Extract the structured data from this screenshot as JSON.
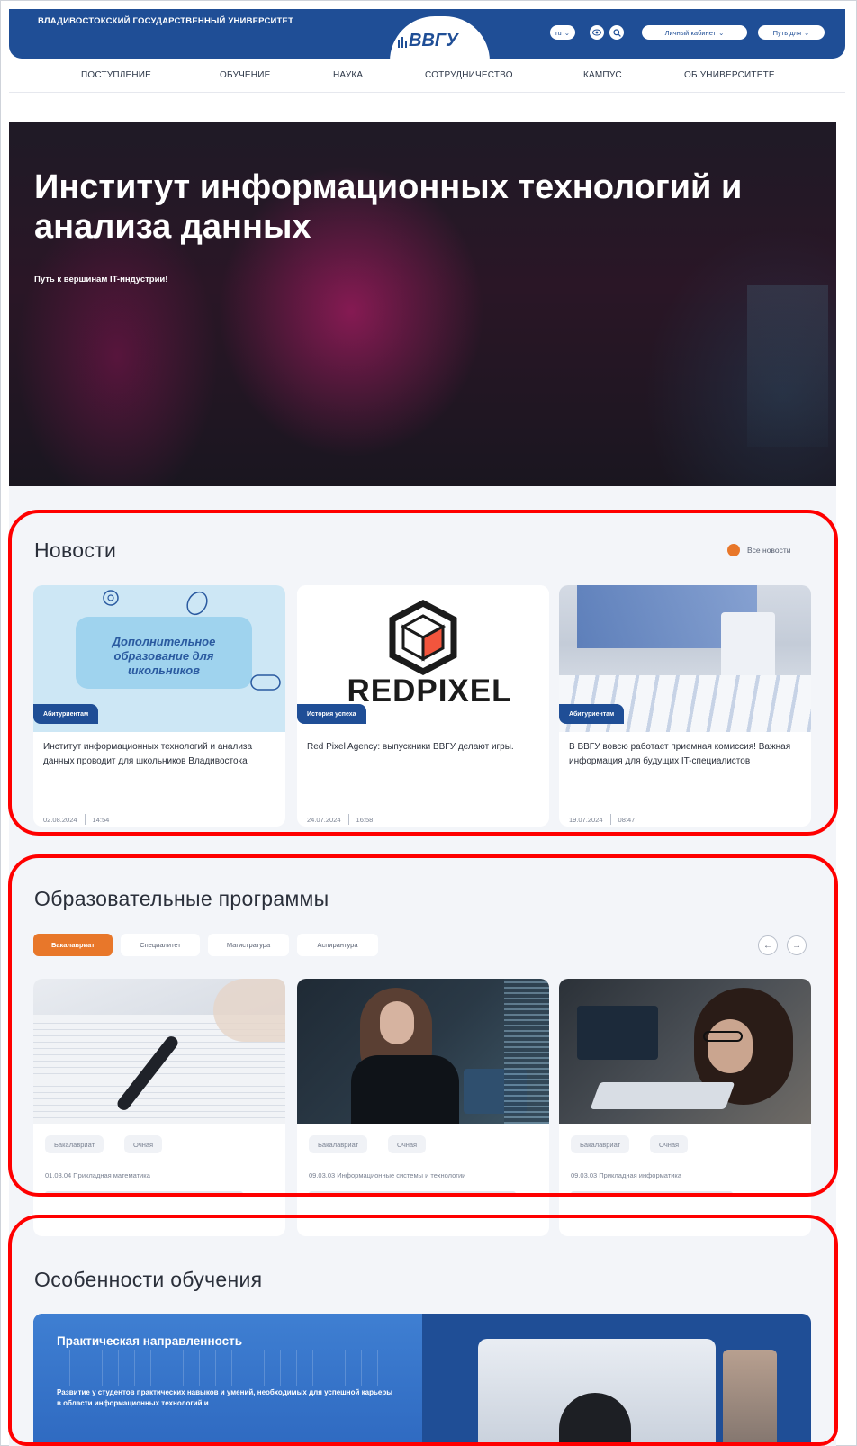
{
  "header": {
    "university": "ВЛАДИВОСТОКСКИЙ ГОСУДАРСТВЕННЫЙ УНИВЕРСИТЕТ",
    "logo": "ВВГУ",
    "lang": "ru",
    "cabinet_label": "Личный кабинет",
    "path_label": "Путь для",
    "brand_color": "#1f4e96"
  },
  "nav": {
    "items": [
      "ПОСТУПЛЕНИЕ",
      "ОБУЧЕНИЕ",
      "НАУКА",
      "СОТРУДНИЧЕСТВО",
      "КАМПУС",
      "ОБ УНИВЕРСИТЕТЕ"
    ]
  },
  "hero": {
    "title": "Институт информационных технологий и анализа данных",
    "subtitle": "Путь к вершинам IT-индустрии!"
  },
  "news": {
    "title": "Новости",
    "all_label": "Все новости",
    "items": [
      {
        "image_text": "Дополнительное образование для школьников",
        "tag": "Абитуриентам",
        "text": "Институт информационных технологий и анализа данных проводит для школьников Владивостока",
        "date": "02.08.2024",
        "time": "14:54"
      },
      {
        "image_text": "REDPIXEL",
        "tag": "История успеха",
        "text": "Red Pixel Agency: выпускники ВВГУ делают игры.",
        "date": "24.07.2024",
        "time": "16:58"
      },
      {
        "image_text": "",
        "tag": "Абитуриентам",
        "text": "В ВВГУ вовсю работает приемная комиссия! Важная информация для будущих IT-специалистов",
        "date": "19.07.2024",
        "time": "08:47"
      }
    ]
  },
  "programs": {
    "title": "Образовательные программы",
    "tabs": [
      "Бакалавриат",
      "Специалитет",
      "Магистратура",
      "Аспирантура"
    ],
    "active_tab": "Бакалавриат",
    "cards": [
      {
        "level": "Бакалавриат",
        "form": "Очная",
        "code": "01.03.04 Прикладная математика"
      },
      {
        "level": "Бакалавриат",
        "form": "Очная",
        "code": "09.03.03 Информационные системы и технологии"
      },
      {
        "level": "Бакалавриат",
        "form": "Очная",
        "code": "09.03.03 Прикладная информатика"
      }
    ]
  },
  "features": {
    "title": "Особенности обучения",
    "card_title": "Практическая направленность",
    "card_text": "Развитие у студентов практических навыков и умений, необходимых для успешной карьеры в области информационных технологий и"
  },
  "colors": {
    "accent": "#e8772a",
    "highlight_outline": "#ff0000"
  }
}
